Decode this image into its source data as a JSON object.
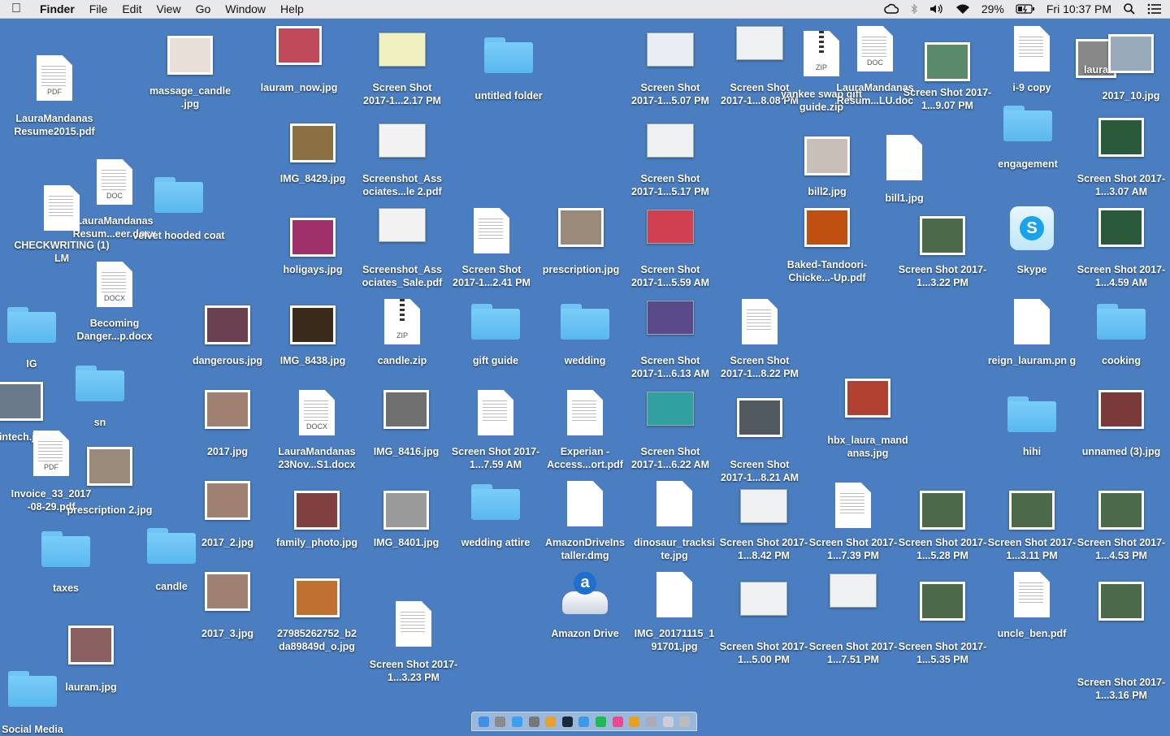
{
  "menubar": {
    "apple": "",
    "app": "Finder",
    "menus": [
      "File",
      "Edit",
      "View",
      "Go",
      "Window",
      "Help"
    ],
    "status": {
      "battery": "29%",
      "clock": "Fri 10:37 PM",
      "icons": [
        "creative-cloud-icon",
        "bluetooth-icon",
        "volume-icon",
        "wifi-icon",
        "battery-icon",
        "spotlight-icon",
        "notification-center-icon"
      ]
    }
  },
  "desktop": {
    "items": [
      {
        "label": "LauraMandanas Resume2015.pdf",
        "icon": "pdf",
        "tag": "PDF"
      },
      {
        "label": "massage_candle .jpg",
        "icon": "photo",
        "color": "#e8e0d8"
      },
      {
        "label": "lauram_now.jpg",
        "icon": "photo",
        "color": "#c04a5a"
      },
      {
        "label": "Screen Shot 2017-1...2.17 PM",
        "icon": "shot",
        "color": "#f0f0c0"
      },
      {
        "label": "untitled folder",
        "icon": "folder"
      },
      {
        "label": "Screen Shot 2017-1...5.07 PM",
        "icon": "shot",
        "color": "#e8eef4"
      },
      {
        "label": "Screen Shot 2017-1...8.08 PM",
        "icon": "shot",
        "color": "#eef0f2"
      },
      {
        "label": "yankee swap gift guide.zip",
        "icon": "zip",
        "tag": "ZIP"
      },
      {
        "label": "LauraMandanas Resum...LU.doc",
        "icon": "doc",
        "tag": "DOC"
      },
      {
        "label": "Screen Shot 2017-1...9.07 PM",
        "icon": "photo",
        "color": "#5a8a6a"
      },
      {
        "label": "i-9 copy",
        "icon": "doclines"
      },
      {
        "label": "laura",
        "icon": "photo",
        "color": "#888"
      },
      {
        "label": "2017_10.jpg",
        "icon": "photo",
        "color": "#9ab"
      },
      {
        "label": "IMG_8429.jpg",
        "icon": "photo",
        "color": "#8a7040"
      },
      {
        "label": "Screenshot_Ass ociates...le 2.pdf",
        "icon": "shot",
        "color": "#f2f2f2"
      },
      {
        "label": "Screen Shot 2017-1...5.17 PM",
        "icon": "shot",
        "color": "#eef0f2"
      },
      {
        "label": "bill2.jpg",
        "icon": "photo",
        "color": "#c8c0b8"
      },
      {
        "label": "bill1.jpg",
        "icon": "blank"
      },
      {
        "label": "engagement",
        "icon": "folder"
      },
      {
        "label": "Screen Shot 2017-1...3.07 AM",
        "icon": "photo",
        "color": "#2a5a3a"
      },
      {
        "label": "LauraMandanas Resum...eer.docx",
        "icon": "doc",
        "tag": "DOC"
      },
      {
        "label": "CHECKWRITING (1) LM",
        "icon": "doclines"
      },
      {
        "label": "velvet hooded coat",
        "icon": "folder"
      },
      {
        "label": "holigays.jpg",
        "icon": "photo",
        "color": "#a0306a"
      },
      {
        "label": "Screenshot_Ass ociates_Sale.pdf",
        "icon": "shot",
        "color": "#f2f2f2"
      },
      {
        "label": "Screen Shot 2017-1...2.41 PM",
        "icon": "doc",
        "tag": ""
      },
      {
        "label": "prescription.jpg",
        "icon": "photo",
        "color": "#9a8a7a"
      },
      {
        "label": "Screen Shot 2017-1...5.59 AM",
        "icon": "shot",
        "color": "#d04050"
      },
      {
        "label": "Baked-Tandoori- Chicke...-Up.pdf",
        "icon": "photo",
        "color": "#c05010"
      },
      {
        "label": "Screen Shot 2017-1...3.22 PM",
        "icon": "photo",
        "color": "#4a6a4a"
      },
      {
        "label": "Skype",
        "icon": "skype"
      },
      {
        "label": "Screen Shot 2017-1...4.59 AM",
        "icon": "photo",
        "color": "#2a5a3a"
      },
      {
        "label": "Becoming Danger...p.docx",
        "icon": "doc",
        "tag": "DOCX"
      },
      {
        "label": "IG",
        "icon": "folder"
      },
      {
        "label": "dangerous.jpg",
        "icon": "photo",
        "color": "#6a4050"
      },
      {
        "label": "IMG_8438.jpg",
        "icon": "photo",
        "color": "#3a2a1a"
      },
      {
        "label": "candle.zip",
        "icon": "zip",
        "tag": "ZIP"
      },
      {
        "label": "gift guide",
        "icon": "folder"
      },
      {
        "label": "wedding",
        "icon": "folder"
      },
      {
        "label": "Screen Shot 2017-1...6.13 AM",
        "icon": "shot",
        "color": "#5a4a8a"
      },
      {
        "label": "Screen Shot 2017-1...8.22 PM",
        "icon": "doc",
        "tag": ""
      },
      {
        "label": "reign_lauram.pn g",
        "icon": "blank"
      },
      {
        "label": "cooking",
        "icon": "folder"
      },
      {
        "label": "cintech.jpg",
        "icon": "photo",
        "color": "#6a7a8a"
      },
      {
        "label": "sn",
        "icon": "folder"
      },
      {
        "label": "2017.jpg",
        "icon": "photo",
        "color": "#a08070"
      },
      {
        "label": "LauraMandanas 23Nov...S1.docx",
        "icon": "doc",
        "tag": "DOCX"
      },
      {
        "label": "IMG_8416.jpg",
        "icon": "photo",
        "color": "#707070"
      },
      {
        "label": "Screen Shot 2017-1...7.59 AM",
        "icon": "doc",
        "tag": ""
      },
      {
        "label": "Experian - Access...ort.pdf",
        "icon": "doclines"
      },
      {
        "label": "Screen Shot 2017-1...6.22 AM",
        "icon": "shot",
        "color": "#30a0a0"
      },
      {
        "label": "Screen Shot 2017-1...8.21 AM",
        "icon": "photo",
        "color": "#505860"
      },
      {
        "label": "hbx_laura_mand anas.jpg",
        "icon": "photo",
        "color": "#b04030"
      },
      {
        "label": "hihi",
        "icon": "folder"
      },
      {
        "label": "unnamed (3).jpg",
        "icon": "photo",
        "color": "#7a3a3a"
      },
      {
        "label": "Invoice_33_2017 -08-29.pdf",
        "icon": "pdf",
        "tag": "PDF"
      },
      {
        "label": "prescription 2.jpg",
        "icon": "photo",
        "color": "#9a8a7a"
      },
      {
        "label": "2017_2.jpg",
        "icon": "photo",
        "color": "#a08070"
      },
      {
        "label": "family_photo.jpg",
        "icon": "photo",
        "color": "#804040"
      },
      {
        "label": "IMG_8401.jpg",
        "icon": "photo",
        "color": "#9a9a9a"
      },
      {
        "label": "wedding attire",
        "icon": "folder"
      },
      {
        "label": "AmazonDriveIns taller.dmg",
        "icon": "blank"
      },
      {
        "label": "dinosaur_tracksi te.jpg",
        "icon": "blank"
      },
      {
        "label": "Screen Shot 2017-1...8.42 PM",
        "icon": "shot",
        "color": "#eef0f2"
      },
      {
        "label": "Screen Shot 2017-1...7.39 PM",
        "icon": "doc",
        "tag": ""
      },
      {
        "label": "Screen Shot 2017-1...5.28 PM",
        "icon": "photo",
        "color": "#4a6a4a"
      },
      {
        "label": "Screen Shot 2017-1...3.11 PM",
        "icon": "photo",
        "color": "#4a6a4a"
      },
      {
        "label": "Screen Shot 2017-1...4.53 PM",
        "icon": "photo",
        "color": "#4a6a4a"
      },
      {
        "label": "taxes",
        "icon": "folder"
      },
      {
        "label": "candle",
        "icon": "folder"
      },
      {
        "label": "2017_3.jpg",
        "icon": "photo",
        "color": "#a08070"
      },
      {
        "label": "27985262752_b2 da89849d_o.jpg",
        "icon": "photo",
        "color": "#c07030"
      },
      {
        "label": "Amazon Drive",
        "icon": "drive"
      },
      {
        "label": "IMG_20171115_1 91701.jpg",
        "icon": "blank"
      },
      {
        "label": "Screen Shot 2017-1...5.00 PM",
        "icon": "shot",
        "color": "#eef0f2"
      },
      {
        "label": "Screen Shot 2017-1...7.51 PM",
        "icon": "shot",
        "color": "#eef0f2"
      },
      {
        "label": "Screen Shot 2017-1...5.35 PM",
        "icon": "photo",
        "color": "#4a6a4a"
      },
      {
        "label": "uncle_ben.pdf",
        "icon": "doclines"
      },
      {
        "label": "Screen Shot 2017-1...3.16 PM",
        "icon": "photo",
        "color": "#4a6a4a"
      },
      {
        "label": "Screen Shot 2017-1...3.23 PM",
        "icon": "doc",
        "tag": ""
      },
      {
        "label": "lauram.jpg",
        "icon": "photo",
        "color": "#8a6060"
      },
      {
        "label": "Social Media",
        "icon": "folder"
      }
    ]
  },
  "dock": {
    "apps": [
      "finder-icon",
      "launchpad-icon",
      "app-store-icon",
      "system-preferences-icon",
      "photos-icon",
      "steam-icon",
      "safari-icon",
      "spotify-icon",
      "itunes-icon",
      "chrome-icon",
      "preview-icon",
      "downloads-icon",
      "trash-icon"
    ]
  },
  "colors": {
    "desktop": "#4a7ec0",
    "folder": "#6cc6f6",
    "menubar": "#e9e9ec"
  }
}
